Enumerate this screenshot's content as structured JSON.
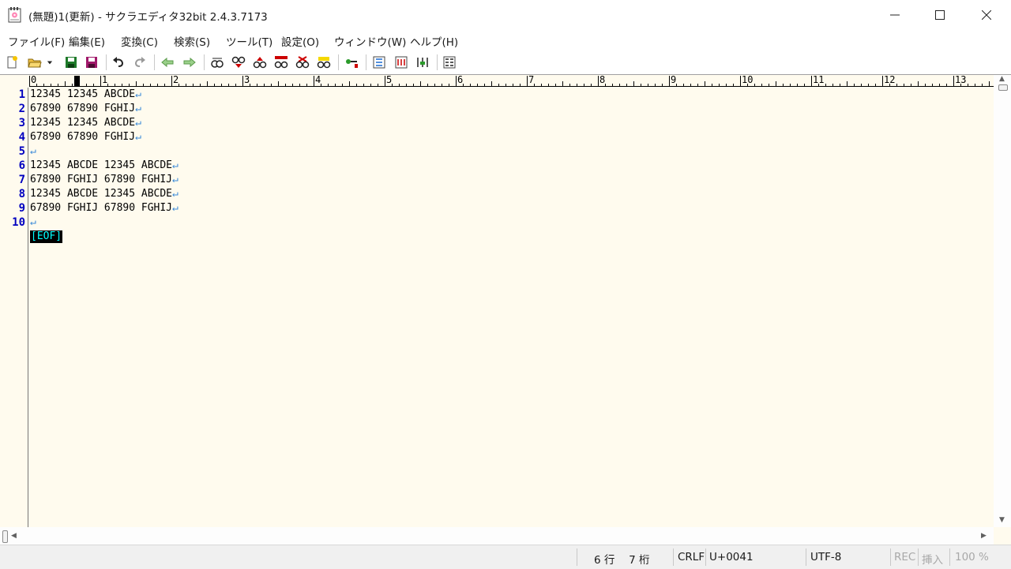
{
  "window": {
    "title": "(無題)1(更新) - サクラエディタ32bit 2.4.3.7173",
    "icon": "sakura-notepad-icon",
    "minimize": "minimize-icon",
    "maximize": "maximize-icon",
    "close": "close-icon"
  },
  "menu": [
    "ファイル(F)",
    "編集(E)",
    "変換(C)",
    "検索(S)",
    "ツール(T)",
    "設定(O)",
    "ウィンドウ(W)",
    "ヘルプ(H)"
  ],
  "toolbar": {
    "icons": [
      "new-file-icon",
      "open-folder-icon",
      "dropdown-arrow-icon",
      "save-icon",
      "save-all-icon",
      "undo-icon",
      "redo-icon",
      "back-icon",
      "forward-icon",
      "find-icon",
      "find-down-icon",
      "find-up-icon",
      "find-grep-icon",
      "find-clear-icon",
      "find-highlight-icon",
      "outline-icon",
      "compare-icon",
      "format-icon",
      "tag-jump-icon",
      "settings-list-icon"
    ]
  },
  "ruler": {
    "labels": [
      "0",
      "1",
      "2",
      "3",
      "4",
      "5",
      "6",
      "7",
      "8",
      "9",
      "10",
      "11",
      "12",
      "13"
    ]
  },
  "editor": {
    "line_numbers": [
      "1",
      "2",
      "3",
      "4",
      "5",
      "6",
      "7",
      "8",
      "9",
      "10"
    ],
    "lines": [
      "12345 12345 ABCDE",
      "67890 67890 FGHIJ",
      "12345 12345 ABCDE",
      "67890 67890 FGHIJ",
      "",
      "12345 ABCDE 12345 ABCDE",
      "67890 FGHIJ 67890 FGHIJ",
      "12345 ABCDE 12345 ABCDE",
      "67890 FGHIJ 67890 FGHIJ",
      ""
    ],
    "eol_mark": "↵",
    "eof_mark": "[EOF]"
  },
  "status": {
    "position": "6 行　 7 桁",
    "eol": "CRLF",
    "codepoint": "U+0041",
    "encoding": "UTF-8",
    "rec": "REC",
    "insert": "挿入",
    "zoom": "100 %"
  }
}
